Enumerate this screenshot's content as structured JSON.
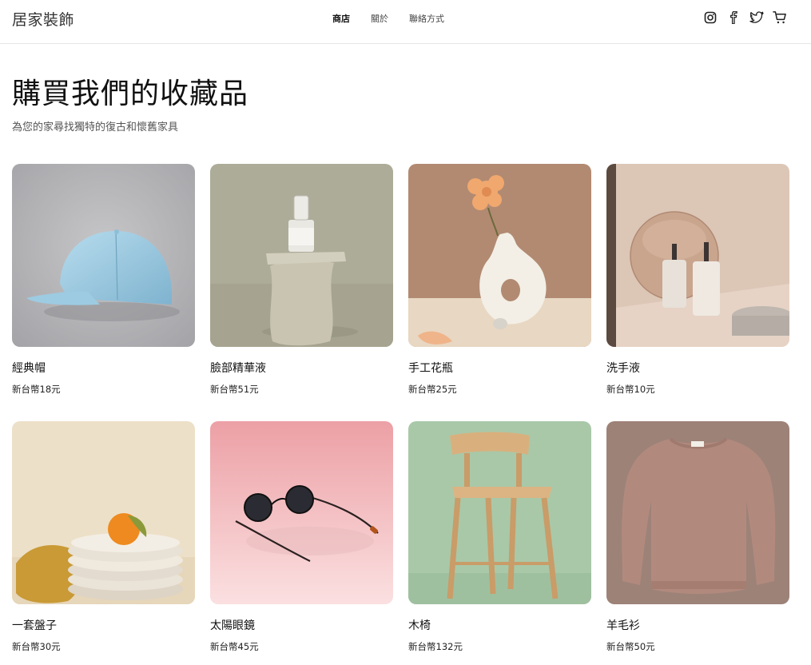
{
  "header": {
    "brand": "居家裝飾",
    "nav": [
      {
        "label": "商店",
        "active": true
      },
      {
        "label": "關於",
        "active": false
      },
      {
        "label": "聯絡方式",
        "active": false
      }
    ],
    "icons": [
      "instagram-icon",
      "facebook-icon",
      "twitter-icon",
      "cart-icon"
    ]
  },
  "main": {
    "title": "購買我們的收藏品",
    "subtitle": "為您的家尋找獨特的復古和懷舊家具",
    "products": [
      {
        "name": "經典帽",
        "price": "新台幣18元",
        "image": "blue-cap"
      },
      {
        "name": "臉部精華液",
        "price": "新台幣51元",
        "image": "serum-bottle-on-stone"
      },
      {
        "name": "手工花瓶",
        "price": "新台幣25元",
        "image": "white-vase-with-flower"
      },
      {
        "name": "洗手液",
        "price": "新台幣10元",
        "image": "soap-bottles-with-mirror"
      },
      {
        "name": "一套盤子",
        "price": "新台幣30元",
        "image": "stacked-plates-with-orange"
      },
      {
        "name": "太陽眼鏡",
        "price": "新台幣45元",
        "image": "round-sunglasses"
      },
      {
        "name": "木椅",
        "price": "新台幣132元",
        "image": "wooden-bar-stool"
      },
      {
        "name": "羊毛衫",
        "price": "新台幣50元",
        "image": "wool-sweater"
      }
    ]
  },
  "colors": {
    "text": "#111111",
    "muted": "#555555",
    "divider": "#e6e6e6"
  }
}
